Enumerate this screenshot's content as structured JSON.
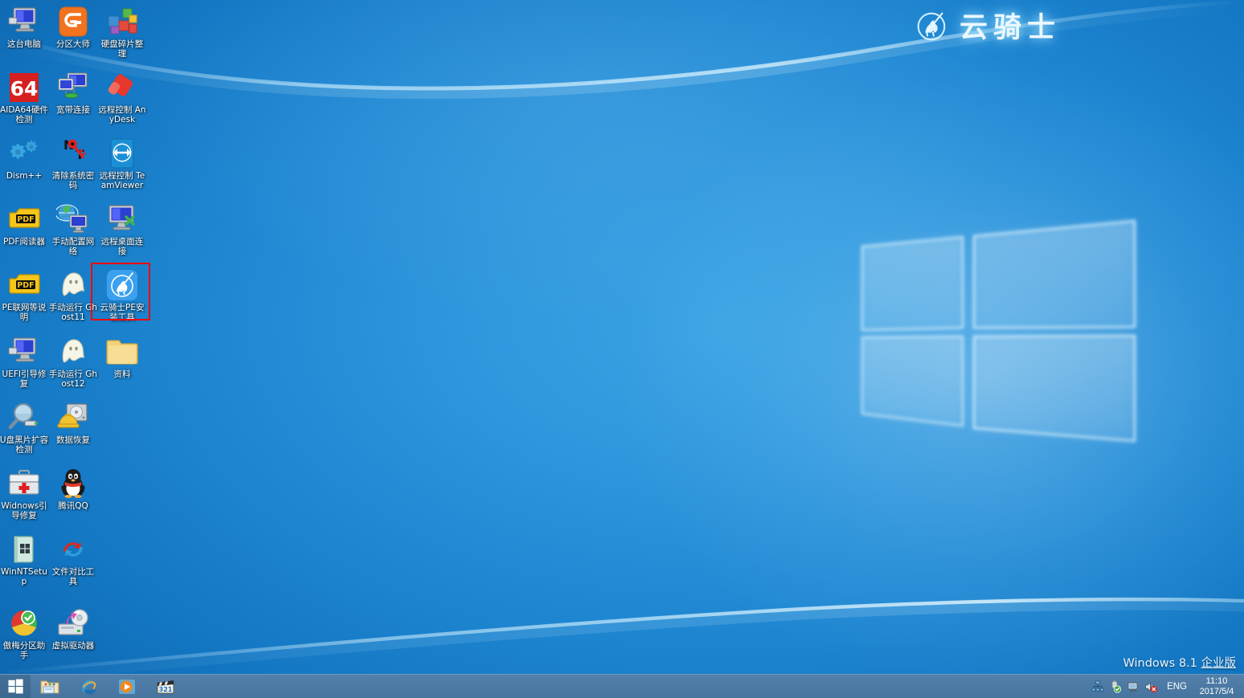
{
  "brand": {
    "text": "云骑士",
    "mark": "knight-emblem-icon",
    "color": "#eaf8ff"
  },
  "desktop": {
    "background_color": "#1f87d2",
    "wallpaper": "windows-perspective-logo",
    "columns_x": [
      30,
      91,
      152
    ],
    "icons": [
      {
        "label": "这台电脑",
        "art": "computer-icon",
        "col": 0,
        "row": 0,
        "selected": false
      },
      {
        "label": "分区大师",
        "art": "diskgenius-icon",
        "col": 1,
        "row": 0,
        "selected": false
      },
      {
        "label": "硬盘碎片整理",
        "art": "defrag-blocks-icon",
        "col": 2,
        "row": 0,
        "selected": false
      },
      {
        "label": "AIDA64硬件检测",
        "art": "aida64-icon",
        "col": 0,
        "row": 1,
        "selected": false
      },
      {
        "label": "宽带连接",
        "art": "broadband-icon",
        "col": 1,
        "row": 1,
        "selected": false
      },
      {
        "label": "远程控制 AnyDesk",
        "art": "anydesk-icon",
        "col": 2,
        "row": 1,
        "selected": false
      },
      {
        "label": "Dism++",
        "art": "dism-gears-icon",
        "col": 0,
        "row": 2,
        "selected": false
      },
      {
        "label": "清除系统密码",
        "art": "ntpwedit-key-icon",
        "col": 1,
        "row": 2,
        "selected": false
      },
      {
        "label": "远程控制 TeamViewer",
        "art": "teamviewer-icon",
        "col": 2,
        "row": 2,
        "selected": false
      },
      {
        "label": "PDF阅读器",
        "art": "pdf-icon",
        "col": 0,
        "row": 3,
        "selected": false
      },
      {
        "label": "手动配置网络",
        "art": "network-config-icon",
        "col": 1,
        "row": 3,
        "selected": false
      },
      {
        "label": "远程桌面连接",
        "art": "remote-desktop-icon",
        "col": 2,
        "row": 3,
        "selected": false
      },
      {
        "label": "PE联网等说明",
        "art": "pdf-icon",
        "col": 0,
        "row": 4,
        "selected": false
      },
      {
        "label": "手动运行 Ghost11",
        "art": "ghost-icon",
        "col": 1,
        "row": 4,
        "selected": false
      },
      {
        "label": "云骑士PE安装工具",
        "art": "yunqishi-pe-icon",
        "col": 2,
        "row": 4,
        "selected": true
      },
      {
        "label": "UEFI引导修复",
        "art": "computer-icon",
        "col": 0,
        "row": 5,
        "selected": false
      },
      {
        "label": "手动运行 Ghost12",
        "art": "ghost-icon",
        "col": 1,
        "row": 5,
        "selected": false
      },
      {
        "label": "资料",
        "art": "folder-icon",
        "col": 2,
        "row": 5,
        "selected": false
      },
      {
        "label": "U盘黑片扩容检测",
        "art": "magnifier-usb-icon",
        "col": 0,
        "row": 6,
        "selected": false
      },
      {
        "label": "数据恢复",
        "art": "hdd-hardhat-icon",
        "col": 1,
        "row": 6,
        "selected": false
      },
      {
        "label": "Widnows引导修复",
        "art": "toolbox-firstaid-icon",
        "col": 0,
        "row": 7,
        "selected": false
      },
      {
        "label": "腾讯QQ",
        "art": "qq-penguin-icon",
        "col": 1,
        "row": 7,
        "selected": false
      },
      {
        "label": "WinNTSetup",
        "art": "winntsetup-icon",
        "col": 0,
        "row": 8,
        "selected": false
      },
      {
        "label": "文件对比工具",
        "art": "sync-arrows-icon",
        "col": 1,
        "row": 8,
        "selected": false
      },
      {
        "label": "傲梅分区助手",
        "art": "aomei-pie-icon",
        "col": 0,
        "row": 9,
        "selected": false
      },
      {
        "label": "虚拟驱动器",
        "art": "virtual-drive-icon",
        "col": 1,
        "row": 9,
        "selected": false
      }
    ]
  },
  "taskbar": {
    "background_color": "#4d7ba6",
    "start": {
      "name": "start-button",
      "art": "windows-logo-icon"
    },
    "pinned": [
      {
        "name": "file-explorer",
        "art": "folder-explorer-icon"
      },
      {
        "name": "internet-explorer",
        "art": "ie-icon"
      },
      {
        "name": "media-player",
        "art": "play-button-icon"
      },
      {
        "name": "mpc-321",
        "art": "clapperboard-321-icon"
      }
    ],
    "tray": [
      {
        "name": "network",
        "art": "network-tree-icon"
      },
      {
        "name": "safely-remove-hardware",
        "art": "usb-check-icon"
      },
      {
        "name": "display",
        "art": "monitor-icon"
      },
      {
        "name": "volume-muted",
        "art": "speaker-mute-icon"
      }
    ],
    "language": "ENG",
    "clock_time": "11:10",
    "clock_date": "2017/5/4"
  },
  "watermark": {
    "product": "Windows 8.1",
    "edition": "企业版"
  }
}
